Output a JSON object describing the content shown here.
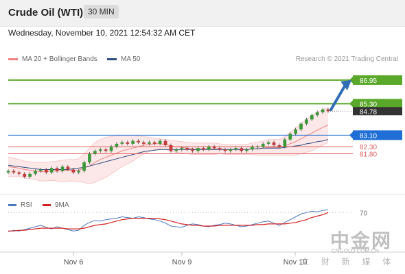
{
  "header": {
    "title": "Crude Oil (WTI)",
    "timeframe": "30 MIN"
  },
  "timestamp": "Wednesday, November 10, 2021 12:54:32 AM CET",
  "legend": {
    "items": [
      {
        "label": "MA 20 + Bollinger Bands",
        "color": "#f08080"
      },
      {
        "label": "MA 50",
        "color": "#2b4c7e"
      }
    ],
    "credit": "Research © 2021 Trading Central"
  },
  "rsi_legend": {
    "items": [
      {
        "label": "RSI",
        "color": "#4a78c2"
      },
      {
        "label": "9MA",
        "color": "#d42020"
      }
    ]
  },
  "watermark": {
    "name": "中金网",
    "url": "CNGOLD.COM.CN",
    "sub": "文 财 新 媒 体"
  },
  "chart_data": [
    {
      "type": "line",
      "title": "Crude Oil (WTI)",
      "x_tick_labels": [
        "Nov 6",
        "Nov 9",
        "Nov 10"
      ],
      "ylim": [
        79.0,
        88.0
      ],
      "levels": [
        {
          "value": 86.95,
          "label": "86.95",
          "color": "#5aa82a",
          "role": "target"
        },
        {
          "value": 85.3,
          "label": "85.30",
          "color": "#5aa82a",
          "role": "resistance"
        },
        {
          "value": 84.78,
          "label": "84.78",
          "color": "#333333",
          "role": "last-price"
        },
        {
          "value": 83.1,
          "label": "83.10",
          "color": "#1f6fd6",
          "role": "pivot"
        },
        {
          "value": 82.3,
          "label": "82.30",
          "color": "#e06060",
          "role": "support"
        },
        {
          "value": 81.8,
          "label": "81.80",
          "color": "#e06060",
          "role": "support"
        }
      ],
      "grid": true,
      "price": [
        80.6,
        80.5,
        80.4,
        80.2,
        80.4,
        80.6,
        80.7,
        80.5,
        80.8,
        80.6,
        80.9,
        80.7,
        80.5,
        80.6,
        81.2,
        81.8,
        82.0,
        82.1,
        82.0,
        82.3,
        82.5,
        82.6,
        82.5,
        82.7,
        82.6,
        82.5,
        82.6,
        82.5,
        82.7,
        82.4,
        82.0,
        82.1,
        82.2,
        82.1,
        82.0,
        82.2,
        82.1,
        82.3,
        82.2,
        82.1,
        82.0,
        82.1,
        82.2,
        82.0,
        82.1,
        82.3,
        82.3,
        82.5,
        82.6,
        82.4,
        82.3,
        82.8,
        83.2,
        83.5,
        83.9,
        84.2,
        84.5,
        84.7,
        84.9,
        84.78
      ],
      "ma20": [
        80.9,
        80.85,
        80.8,
        80.7,
        80.65,
        80.6,
        80.55,
        80.55,
        80.6,
        80.6,
        80.6,
        80.65,
        80.65,
        80.65,
        80.8,
        80.95,
        81.2,
        81.4,
        81.55,
        81.7,
        81.85,
        82.0,
        82.1,
        82.2,
        82.3,
        82.4,
        82.45,
        82.5,
        82.5,
        82.45,
        82.35,
        82.3,
        82.25,
        82.2,
        82.15,
        82.15,
        82.15,
        82.15,
        82.15,
        82.15,
        82.1,
        82.1,
        82.1,
        82.1,
        82.1,
        82.15,
        82.15,
        82.2,
        82.25,
        82.25,
        82.25,
        82.35,
        82.5,
        82.65,
        82.85,
        83.05,
        83.25,
        83.45,
        83.65,
        83.8
      ],
      "bb_upper": [
        81.6,
        81.5,
        81.4,
        81.3,
        81.25,
        81.2,
        81.2,
        81.2,
        81.25,
        81.3,
        81.35,
        81.4,
        81.4,
        81.45,
        81.8,
        82.2,
        82.6,
        82.8,
        82.95,
        83.0,
        83.05,
        83.1,
        83.1,
        83.1,
        83.05,
        83.0,
        82.95,
        82.9,
        82.85,
        82.8,
        82.75,
        82.7,
        82.65,
        82.6,
        82.55,
        82.55,
        82.55,
        82.55,
        82.55,
        82.5,
        82.45,
        82.45,
        82.45,
        82.45,
        82.45,
        82.55,
        82.6,
        82.7,
        82.8,
        82.8,
        82.8,
        83.0,
        83.3,
        83.6,
        83.9,
        84.2,
        84.5,
        84.7,
        84.9,
        85.0
      ],
      "bb_lower": [
        80.2,
        80.2,
        80.2,
        80.1,
        80.05,
        80.0,
        79.9,
        79.9,
        79.95,
        79.9,
        79.85,
        79.9,
        79.9,
        79.85,
        79.8,
        79.7,
        79.8,
        80.0,
        80.15,
        80.4,
        80.65,
        80.9,
        81.1,
        81.3,
        81.55,
        81.8,
        81.95,
        82.1,
        82.15,
        82.1,
        81.95,
        81.9,
        81.85,
        81.8,
        81.75,
        81.75,
        81.75,
        81.75,
        81.75,
        81.8,
        81.75,
        81.75,
        81.75,
        81.75,
        81.75,
        81.75,
        81.7,
        81.7,
        81.7,
        81.7,
        81.7,
        81.7,
        81.7,
        81.7,
        81.8,
        81.9,
        82.0,
        82.2,
        82.4,
        82.6
      ],
      "ma50": [
        81.0,
        80.95,
        80.9,
        80.85,
        80.8,
        80.75,
        80.7,
        80.7,
        80.7,
        80.7,
        80.7,
        80.7,
        80.75,
        80.8,
        80.85,
        80.95,
        81.05,
        81.15,
        81.25,
        81.35,
        81.45,
        81.55,
        81.65,
        81.75,
        81.85,
        81.95,
        82.0,
        82.05,
        82.1,
        82.1,
        82.1,
        82.1,
        82.1,
        82.1,
        82.1,
        82.1,
        82.1,
        82.1,
        82.1,
        82.1,
        82.1,
        82.1,
        82.1,
        82.1,
        82.1,
        82.15,
        82.15,
        82.2,
        82.2,
        82.2,
        82.2,
        82.25,
        82.3,
        82.35,
        82.4,
        82.5,
        82.55,
        82.65,
        82.7,
        82.8
      ],
      "arrow_target": 86.95
    },
    {
      "type": "line",
      "title": "RSI",
      "ylim": [
        20,
        80
      ],
      "reference_level": {
        "value": 70,
        "label": "70"
      },
      "rsi": [
        43,
        45,
        44,
        46,
        48,
        50,
        52,
        49,
        47,
        50,
        48,
        46,
        44,
        45,
        52,
        56,
        59,
        58,
        60,
        61,
        62,
        64,
        63,
        62,
        64,
        63,
        61,
        60,
        58,
        55,
        51,
        50,
        49,
        52,
        54,
        53,
        51,
        50,
        52,
        53,
        55,
        54,
        52,
        50,
        51,
        53,
        55,
        57,
        58,
        55,
        52,
        56,
        60,
        64,
        68,
        70,
        72,
        71,
        73,
        74
      ],
      "rsi_ma9": [
        44,
        44,
        45,
        45,
        46,
        47,
        48,
        48,
        48,
        48,
        48,
        47,
        47,
        47,
        48,
        50,
        52,
        53,
        54,
        56,
        58,
        60,
        61,
        62,
        62,
        62,
        62,
        62,
        61,
        60,
        58,
        56,
        54,
        53,
        52,
        52,
        51,
        51,
        51,
        52,
        52,
        52,
        52,
        52,
        52,
        52,
        53,
        53,
        54,
        54,
        54,
        54,
        55,
        56,
        58,
        60,
        63,
        65,
        67,
        70
      ]
    }
  ]
}
